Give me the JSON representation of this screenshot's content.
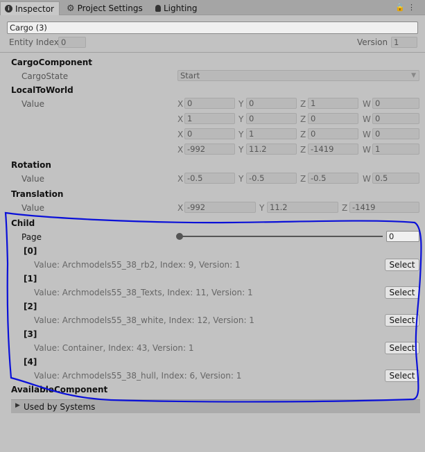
{
  "tabs": [
    {
      "label": "Inspector",
      "icon": "info-icon"
    },
    {
      "label": "Project Settings",
      "icon": "gear-icon"
    },
    {
      "label": "Lighting",
      "icon": "bulb-icon"
    }
  ],
  "entity": {
    "name": "Cargo (3)",
    "index_label": "Entity Index",
    "index": "0",
    "version_label": "Version",
    "version": "1"
  },
  "cargo": {
    "title": "CargoComponent",
    "state_label": "CargoState",
    "state_value": "Start"
  },
  "ltw": {
    "title": "LocalToWorld",
    "value_label": "Value",
    "rows": [
      [
        "0",
        "0",
        "1",
        "0"
      ],
      [
        "1",
        "0",
        "0",
        "0"
      ],
      [
        "0",
        "1",
        "0",
        "0"
      ],
      [
        "-992",
        "11.2",
        "-1419",
        "1"
      ]
    ]
  },
  "rotation": {
    "title": "Rotation",
    "value_label": "Value",
    "x": "-0.5",
    "y": "-0.5",
    "z": "-0.5",
    "w": "0.5"
  },
  "translation": {
    "title": "Translation",
    "value_label": "Value",
    "x": "-992",
    "y": "11.2",
    "z": "-1419"
  },
  "axes": {
    "x": "X",
    "y": "Y",
    "z": "Z",
    "w": "W"
  },
  "child": {
    "title": "Child",
    "page_label": "Page",
    "page_value": "0",
    "select_label": "Select",
    "items": [
      {
        "index": "[0]",
        "value": "Value: Archmodels55_38_rb2, Index: 9, Version: 1"
      },
      {
        "index": "[1]",
        "value": "Value: Archmodels55_38_Texts, Index: 11, Version: 1"
      },
      {
        "index": "[2]",
        "value": "Value: Archmodels55_38_white, Index: 12, Version: 1"
      },
      {
        "index": "[3]",
        "value": "Value: Container, Index: 43, Version: 1"
      },
      {
        "index": "[4]",
        "value": "Value: Archmodels55_38_hull, Index: 6, Version: 1"
      }
    ]
  },
  "available": {
    "title": "AvailableComponent"
  },
  "used_by": {
    "label": "Used by Systems"
  },
  "colors": {
    "annotation": "#0a10d8",
    "background": "#c2c2c2",
    "tabbar": "#a5a5a5"
  }
}
